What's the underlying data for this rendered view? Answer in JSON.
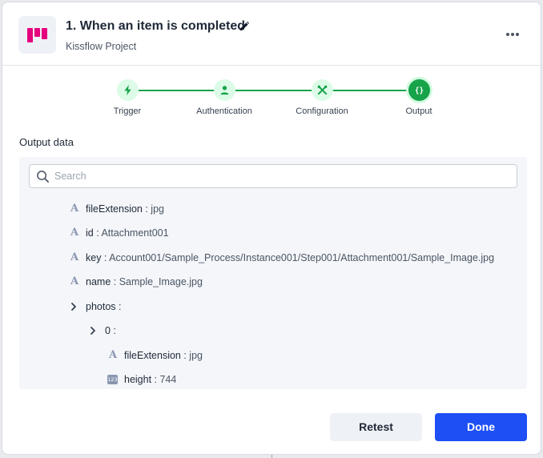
{
  "header": {
    "title": "1. When an item is completed",
    "subtitle": "Kissflow Project",
    "logo_color": "#e5007e"
  },
  "stepper": {
    "line_color": "#16a34a",
    "steps": [
      {
        "label": "Trigger",
        "icon": "lightning-icon",
        "active": false
      },
      {
        "label": "Authentication",
        "icon": "user-icon",
        "active": false
      },
      {
        "label": "Configuration",
        "icon": "tools-icon",
        "active": false
      },
      {
        "label": "Output",
        "icon": "braces-icon",
        "active": true
      }
    ]
  },
  "output": {
    "section_title": "Output data",
    "search_placeholder": "Search",
    "rows": [
      {
        "type": "text",
        "key": "fileExtension",
        "value": "jpg"
      },
      {
        "type": "text",
        "key": "id",
        "value": "Attachment001"
      },
      {
        "type": "text",
        "key": "key",
        "value": "Account001/Sample_Process/Instance001/Step001/Attachment001/Sample_Image.jpg"
      },
      {
        "type": "text",
        "key": "name",
        "value": "Sample_Image.jpg"
      },
      {
        "type": "object",
        "key": "photos",
        "expanded": true
      },
      {
        "type": "object",
        "key": "0",
        "expanded": true
      },
      {
        "type": "text",
        "key": "fileExtension",
        "value": "jpg"
      },
      {
        "type": "number",
        "key": "height",
        "value": "744"
      }
    ],
    "number_icon_text": "123"
  },
  "footer": {
    "retest_label": "Retest",
    "done_label": "Done",
    "done_color": "#1d4ff5"
  }
}
